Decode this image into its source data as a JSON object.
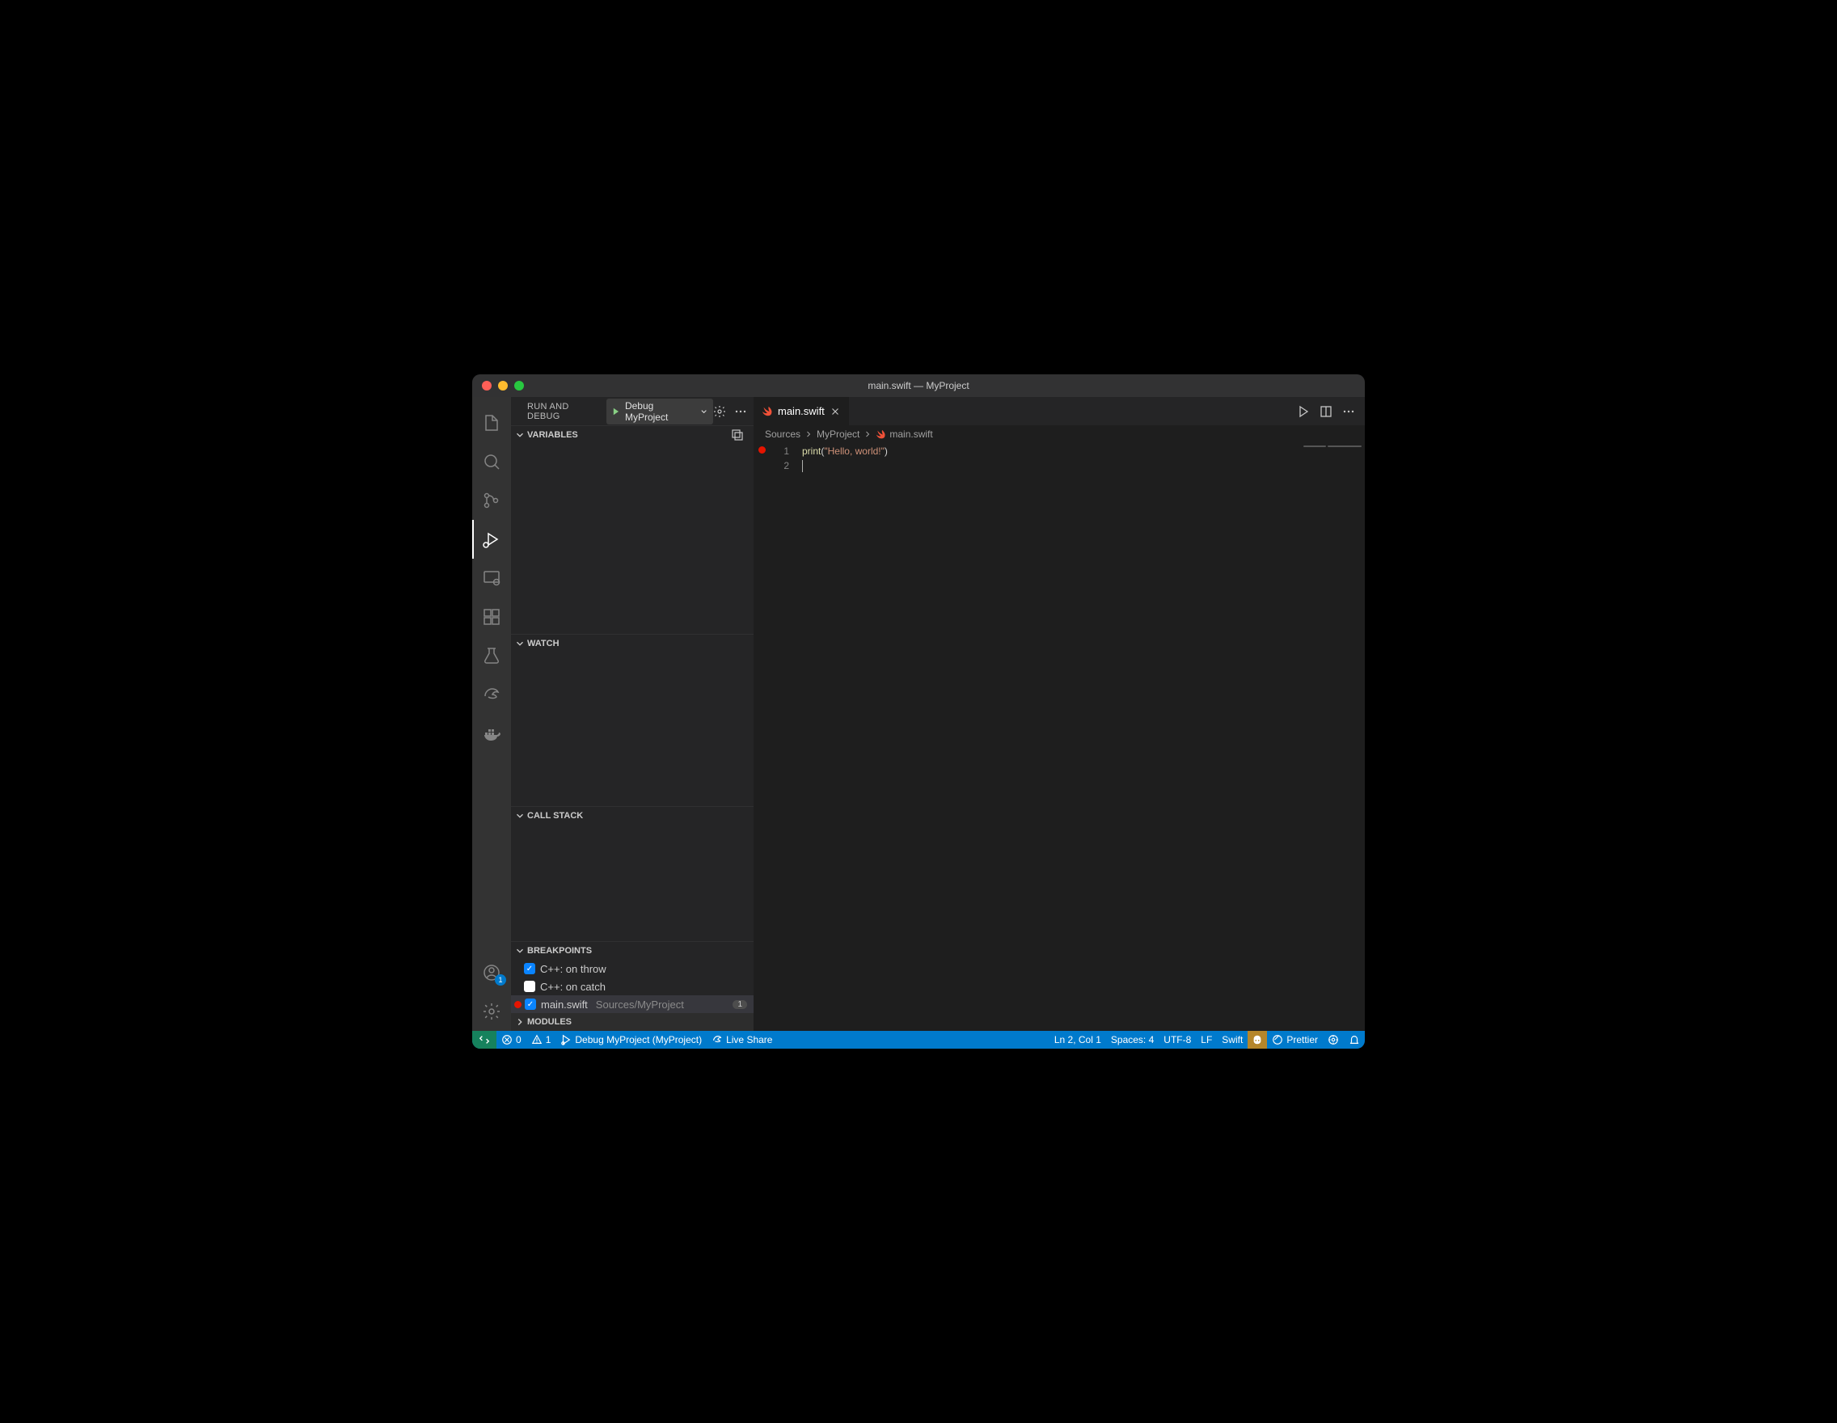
{
  "title": "main.swift — MyProject",
  "sidebar_title": "RUN AND DEBUG",
  "config": "Debug MyProject",
  "sections": {
    "variables": "VARIABLES",
    "watch": "WATCH",
    "callstack": "CALL STACK",
    "breakpoints": "BREAKPOINTS",
    "modules": "MODULES"
  },
  "breakpoints": [
    {
      "label": "C++: on throw",
      "checked": true
    },
    {
      "label": "C++: on catch",
      "checked": false
    },
    {
      "label": "main.swift",
      "checked": true,
      "path": "Sources/MyProject",
      "count": "1",
      "file": true
    }
  ],
  "tab": "main.swift",
  "crumbs": [
    "Sources",
    "MyProject",
    "main.swift"
  ],
  "code": {
    "line1": {
      "fn": "print",
      "pn1": "(",
      "str": "\"Hello, world!\"",
      "pn2": ")"
    },
    "linenums": [
      "1",
      "2"
    ]
  },
  "status": {
    "errors": "0",
    "warnings": "1",
    "debug": "Debug MyProject (MyProject)",
    "liveshare": "Live Share",
    "lncol": "Ln 2, Col 1",
    "spaces": "Spaces: 4",
    "encoding": "UTF-8",
    "eol": "LF",
    "lang": "Swift",
    "prettier": "Prettier"
  },
  "accounts_badge": "1"
}
